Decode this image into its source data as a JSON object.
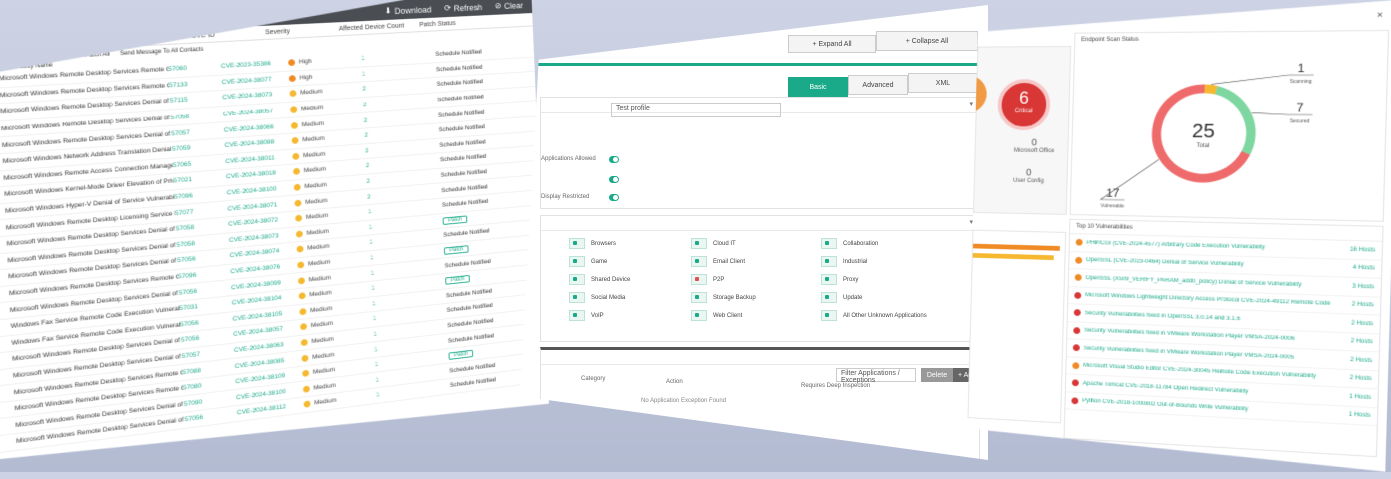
{
  "left": {
    "topbar": {
      "download_label": "Download",
      "refresh_label": "Refresh",
      "clear_label": "Clear"
    },
    "toolbar": {
      "item1": "Severity Score Information",
      "item2": "Patch All",
      "item3": "Send Message To All Contacts"
    },
    "columns": [
      "Vulnerability Name",
      "Port Count ID",
      "CVE ID",
      "Severity",
      "Affected Device Count",
      "Patch Status"
    ],
    "rows": [
      {
        "name": "Microsoft Windows Remote Desktop Services Remote Code Execution",
        "svc": "57060",
        "cve": "CVE-2023-35386",
        "sev": "High",
        "color": "#f08a24",
        "cnt": "1",
        "status": "Schedule Notified"
      },
      {
        "name": "Microsoft Windows Remote Desktop Services Remote Code Execution",
        "svc": "57133",
        "cve": "CVE-2024-38077",
        "sev": "High",
        "color": "#f08a24",
        "cnt": "1",
        "status": "Schedule Notified"
      },
      {
        "name": "Microsoft Windows Remote Desktop Services Denial of Privilege Escalation",
        "svc": "57115",
        "cve": "CVE-2024-38073",
        "sev": "Medium",
        "color": "#f5b82e",
        "cnt": "2",
        "status": "Schedule Notified"
      },
      {
        "name": "Microsoft Windows Remote Desktop Services Denial of Privilege Escalation",
        "svc": "57058",
        "cve": "CVE-2024-38057",
        "sev": "Medium",
        "color": "#f5b82e",
        "cnt": "2",
        "status": "Schedule Notified"
      },
      {
        "name": "Microsoft Windows Remote Desktop Services Denial of Privilege Escalation",
        "svc": "57057",
        "cve": "CVE-2024-38066",
        "sev": "Medium",
        "color": "#f5b82e",
        "cnt": "2",
        "status": "Schedule Notified"
      },
      {
        "name": "Microsoft Windows Network Address Translation Denial of Service",
        "svc": "57059",
        "cve": "CVE-2024-38088",
        "sev": "Medium",
        "color": "#f5b82e",
        "cnt": "2",
        "status": "Schedule Notified"
      },
      {
        "name": "Microsoft Windows Remote Access Connection Manager",
        "svc": "57065",
        "cve": "CVE-2024-38011",
        "sev": "Medium",
        "color": "#f5b82e",
        "cnt": "2",
        "status": "Schedule Notified"
      },
      {
        "name": "Microsoft Windows Kernel-Mode Driver Elevation of Privilege",
        "svc": "57021",
        "cve": "CVE-2024-38018",
        "sev": "Medium",
        "color": "#f5b82e",
        "cnt": "2",
        "status": "Schedule Notified"
      },
      {
        "name": "Microsoft Windows Hyper-V Denial of Service Vulnerability",
        "svc": "57096",
        "cve": "CVE-2024-38100",
        "sev": "Medium",
        "color": "#f5b82e",
        "cnt": "2",
        "status": "Schedule Notified"
      },
      {
        "name": "Microsoft Windows Remote Desktop Licensing Service Remote Code",
        "svc": "57077",
        "cve": "CVE-2024-38071",
        "sev": "Medium",
        "color": "#f5b82e",
        "cnt": "2",
        "status": "Schedule Notified"
      },
      {
        "name": "Microsoft Windows Remote Desktop Services Denial of Privilege Escalation",
        "svc": "57058",
        "cve": "CVE-2024-38072",
        "sev": "Medium",
        "color": "#f5b82e",
        "cnt": "1",
        "status": "Schedule Notified"
      },
      {
        "name": "Microsoft Windows Remote Desktop Services Denial of Privilege Escalation",
        "svc": "57058",
        "cve": "CVE-2024-38073",
        "sev": "Medium",
        "color": "#f5b82e",
        "cnt": "1",
        "status": "Patch"
      },
      {
        "name": "Microsoft Windows Remote Desktop Services Denial of Privilege Escalation",
        "svc": "57056",
        "cve": "CVE-2024-38074",
        "sev": "Medium",
        "color": "#f5b82e",
        "cnt": "1",
        "status": "Schedule Notified"
      },
      {
        "name": "Microsoft Windows Remote Desktop Services Remote Code Execution",
        "svc": "57096",
        "cve": "CVE-2024-38076",
        "sev": "Medium",
        "color": "#f5b82e",
        "cnt": "1",
        "status": "Patch"
      },
      {
        "name": "Microsoft Windows Remote Desktop Services Denial of Privilege Escalation",
        "svc": "57056",
        "cve": "CVE-2024-38099",
        "sev": "Medium",
        "color": "#f5b82e",
        "cnt": "1",
        "status": "Schedule Notified"
      },
      {
        "name": "Windows Fax Service Remote Code Execution Vulnerability",
        "svc": "57031",
        "cve": "CVE-2024-38104",
        "sev": "Medium",
        "color": "#f5b82e",
        "cnt": "1",
        "status": "Patch"
      },
      {
        "name": "Windows Fax Service Remote Code Execution Vulnerability",
        "svc": "57056",
        "cve": "CVE-2024-38105",
        "sev": "Medium",
        "color": "#f5b82e",
        "cnt": "1",
        "status": "Schedule Notified"
      },
      {
        "name": "Microsoft Windows Remote Desktop Services Denial of Privilege Escalation",
        "svc": "57056",
        "cve": "CVE-2024-38057",
        "sev": "Medium",
        "color": "#f5b82e",
        "cnt": "1",
        "status": "Schedule Notified"
      },
      {
        "name": "Microsoft Windows Remote Desktop Services Denial of Privilege Escalation",
        "svc": "57057",
        "cve": "CVE-2024-38063",
        "sev": "Medium",
        "color": "#f5b82e",
        "cnt": "1",
        "status": "Schedule Notified"
      },
      {
        "name": "Microsoft Windows Remote Desktop Services Remote Code Execution",
        "svc": "57088",
        "cve": "CVE-2024-38085",
        "sev": "Medium",
        "color": "#f5b82e",
        "cnt": "1",
        "status": "Schedule Notified"
      },
      {
        "name": "Microsoft Windows Remote Desktop Services Remote Code Execution",
        "svc": "57080",
        "cve": "CVE-2024-38109",
        "sev": "Medium",
        "color": "#f5b82e",
        "cnt": "1",
        "status": "Patch"
      },
      {
        "name": "Microsoft Windows Remote Desktop Services Denial of Privilege Escalation",
        "svc": "57090",
        "cve": "CVE-2024-38100",
        "sev": "Medium",
        "color": "#f5b82e",
        "cnt": "1",
        "status": "Schedule Notified"
      },
      {
        "name": "Microsoft Windows Remote Desktop Services Denial of Privilege Escalation",
        "svc": "57056",
        "cve": "CVE-2024-38112",
        "sev": "Medium",
        "color": "#f5b82e",
        "cnt": "1",
        "status": "Schedule Notified"
      }
    ]
  },
  "mid": {
    "expand_all": "+ Expand All",
    "collapse_all": "+ Collapse All",
    "seg_basic": "Basic",
    "seg_advanced": "Advanced",
    "seg_xml": "XML",
    "name_field": "Test profile",
    "toggle_label_1": "Applications Allowed",
    "toggle_label_3": "Display Restricted",
    "apps": [
      [
        "Browsers",
        "Cloud IT",
        "Collaboration"
      ],
      [
        "Game",
        "Email Client",
        "Industrial"
      ],
      [
        "Shared Device",
        "P2P",
        "Proxy"
      ],
      [
        "Social Media",
        "Storage Backup",
        "Update"
      ],
      [
        "VoIP",
        "Web Client",
        "All Other Unknown Applications"
      ]
    ],
    "search_placeholder": "Filter Applications / Exceptions",
    "delete_label": "Delete",
    "add_label": "+ Add",
    "col_category": "Category",
    "col_action": "Action",
    "col_exception": "Requires Deep Inspection",
    "empty_text": "No Application Exception Found"
  },
  "right": {
    "critical_count": "6",
    "critical_label": "Critical",
    "small_stats": [
      {
        "v": "0",
        "l": "Microsoft Office"
      },
      {
        "v": "0",
        "l": "User Config"
      }
    ],
    "donut": {
      "title": "Endpoint Scan Status",
      "total": "25",
      "total_label": "Total",
      "segments": [
        {
          "name": "Scanning",
          "value": 1,
          "color": "#f5b82e"
        },
        {
          "name": "Secured",
          "value": 7,
          "color": "#7ed6a0"
        },
        {
          "name": "Vulnerable",
          "value": 17,
          "color": "#ef6b6b"
        }
      ]
    },
    "vuln_title": "Top 10 Vulnerabilities",
    "vulns": [
      {
        "t": "PHP/CGI (CVE-2024-4577) Arbitrary Code Execution Vulnerability",
        "h": "16 Hosts",
        "c": "#f08a24"
      },
      {
        "t": "OpenSSL (CVE-2023-0464) Denial of Service Vulnerability",
        "h": "4 Hosts",
        "c": "#f08a24"
      },
      {
        "t": "OpenSSL (X509_VERIFY_PARAM_add0_policy) Denial of Service Vulnerability",
        "h": "3 Hosts",
        "c": "#f08a24"
      },
      {
        "t": "Microsoft Windows Lightweight Directory Access Protocol CVE-2024-49112 Remote Code Execution Vulnerability",
        "h": "2 Hosts",
        "c": "#d93636"
      },
      {
        "t": "Security Vulnerabilities fixed in OpenSSL 3.0.14 and 3.1.6",
        "h": "2 Hosts",
        "c": "#d93636"
      },
      {
        "t": "Security Vulnerabilities fixed in VMware Workstation Player VMSA-2024-0006",
        "h": "2 Hosts",
        "c": "#d93636"
      },
      {
        "t": "Security Vulnerabilities fixed in VMware Workstation Player VMSA-2024-0005",
        "h": "2 Hosts",
        "c": "#d93636"
      },
      {
        "t": "Microsoft Visual Studio Editor CVE-2024-30045 Remote Code Execution Vulnerability",
        "h": "2 Hosts",
        "c": "#f08a24"
      },
      {
        "t": "Apache Tomcat CVE-2018-11784 Open Redirect Vulnerability",
        "h": "1 Hosts",
        "c": "#d93636"
      },
      {
        "t": "Python CVE-2018-1000802 Out-of-Bounds Write Vulnerability",
        "h": "1 Hosts",
        "c": "#d93636"
      }
    ],
    "close_label": "×"
  }
}
